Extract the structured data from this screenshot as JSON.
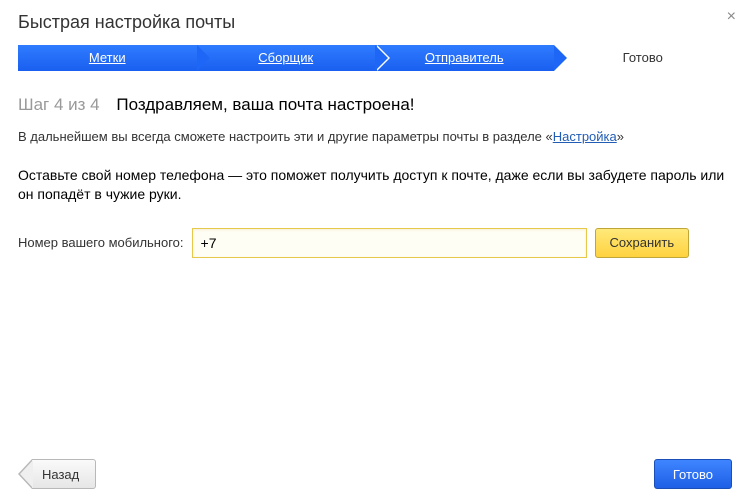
{
  "title": "Быстрая настройка почты",
  "close_symbol": "×",
  "steps": {
    "items": [
      {
        "label": "Метки"
      },
      {
        "label": "Сборщик"
      },
      {
        "label": "Отправитель"
      },
      {
        "label": "Готово"
      }
    ]
  },
  "heading": {
    "step_counter": "Шаг 4 из 4",
    "title": "Поздравляем, ваша почта настроена!"
  },
  "description": {
    "prefix": "В дальнейшем вы всегда сможете настроить эти и другие параметры почты в разделе «",
    "link": "Настройка",
    "suffix": "»"
  },
  "info": "Оставьте свой номер телефона — это поможет получить доступ к почте, даже если вы забудете пароль или он попадёт в чужие руки.",
  "phone": {
    "label": "Номер вашего мобильного:",
    "value": "+7",
    "save_label": "Сохранить"
  },
  "footer": {
    "back_label": "Назад",
    "done_label": "Готово"
  }
}
